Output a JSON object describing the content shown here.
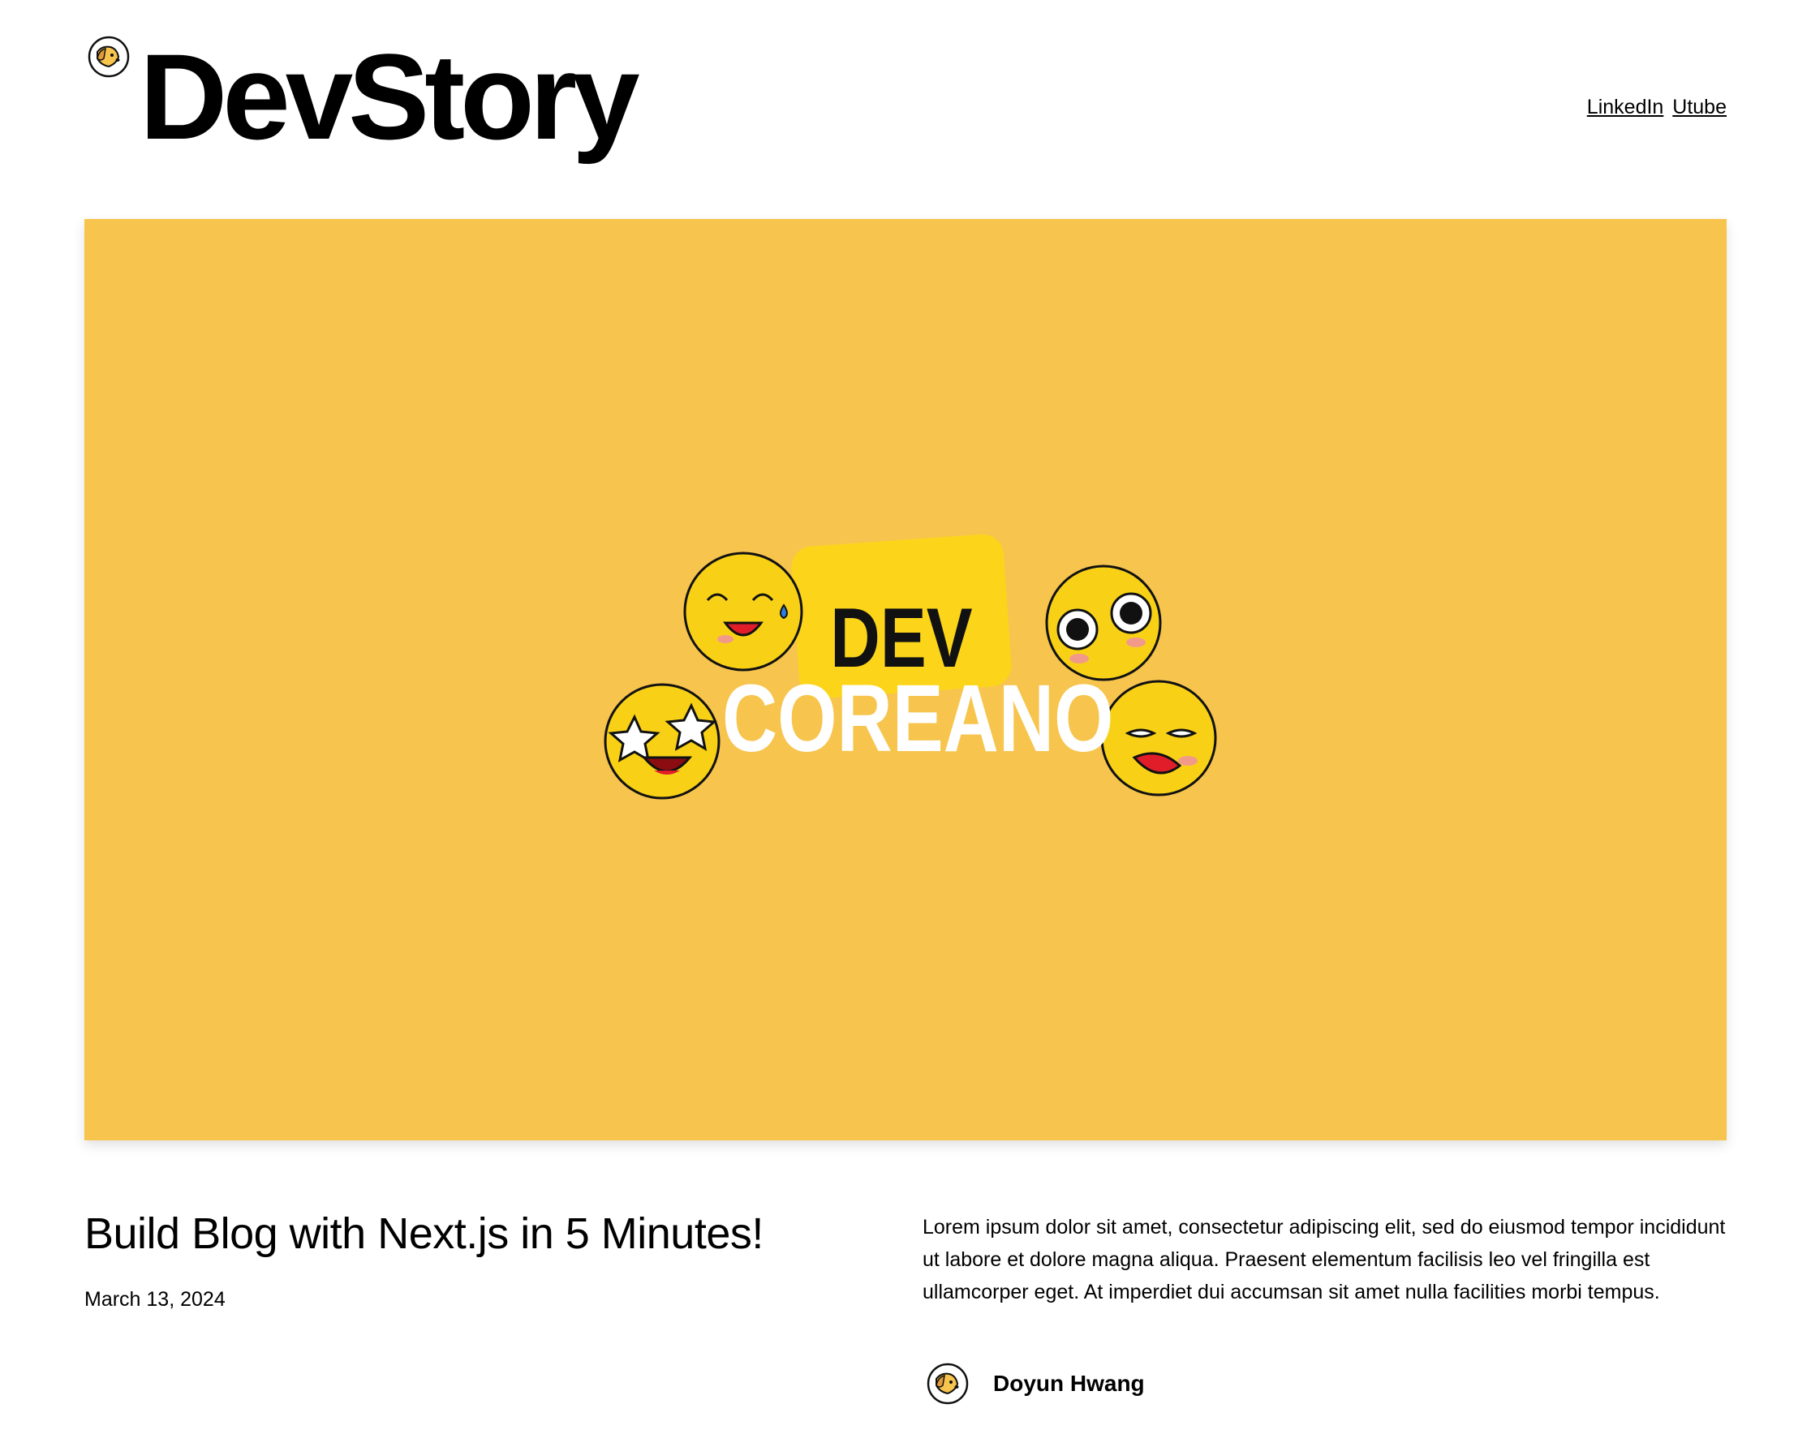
{
  "header": {
    "site_title": "DevStory",
    "nav": [
      {
        "label": "LinkedIn"
      },
      {
        "label": "Utube"
      }
    ]
  },
  "hero": {
    "background_color": "#f7c44d",
    "badge_color": "#fcd51a",
    "badge_text": "DEV",
    "main_text": "COREANO",
    "icons": [
      "sweat-laughing-emoji-icon",
      "dizzy-eyes-emoji-icon",
      "star-eyes-laughing-emoji-icon",
      "crying-emoji-icon"
    ]
  },
  "post": {
    "title": "Build Blog with Next.js in 5 Minutes!",
    "date": "March 13, 2024",
    "excerpt": "Lorem ipsum dolor sit amet, consectetur adipiscing elit, sed do eiusmod tempor incididunt ut labore et dolore magna aliqua. Praesent elementum facilisis leo vel fringilla est ullamcorper eget. At imperdiet dui accumsan sit amet nulla facilities morbi tempus.",
    "author": {
      "name": "Doyun Hwang",
      "avatar_icon": "dog-avatar-icon"
    }
  }
}
